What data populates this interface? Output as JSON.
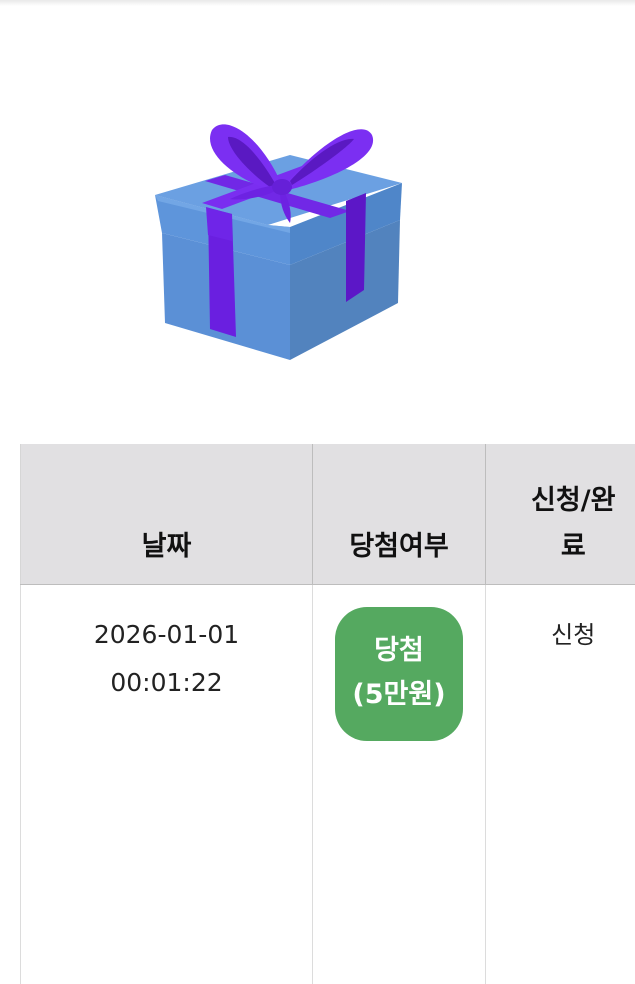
{
  "table": {
    "headers": {
      "date": "날짜",
      "win_status": "당첨여부",
      "apply_line1": "신청/완",
      "apply_line2": "료"
    },
    "rows": [
      {
        "date_line1": "2026-01-01",
        "date_line2": "00:01:22",
        "badge_line1": "당첨",
        "badge_line2": "(5만원)",
        "badge_color": "#55a960",
        "apply_status": "신청"
      }
    ]
  },
  "icons": {
    "gift": "gift-box-icon"
  },
  "colors": {
    "header_bg": "#e1e0e2",
    "win_badge": "#55a960",
    "ribbon": "#7a2ef0",
    "box": "#5a92dc"
  }
}
